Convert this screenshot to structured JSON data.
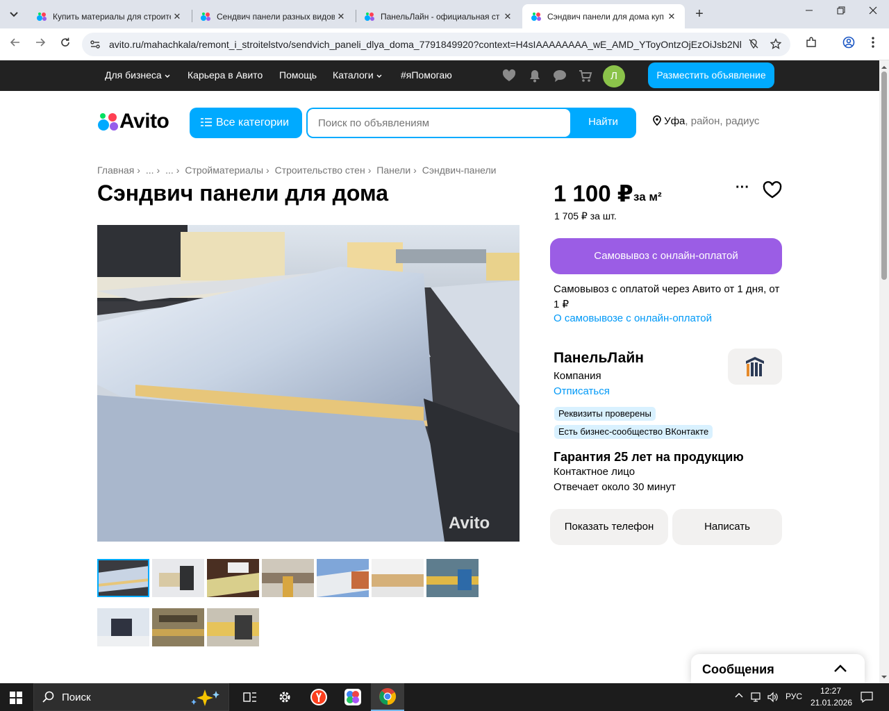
{
  "browser": {
    "tabs": [
      {
        "title": "Купить материалы для строите",
        "active": false
      },
      {
        "title": "Сендвич панели разных видов",
        "active": false
      },
      {
        "title": "ПанельЛайн - официальная ст",
        "active": false
      },
      {
        "title": "Сэндвич панели для дома куп",
        "active": true
      }
    ],
    "close_glyph": "✕",
    "new_tab_glyph": "+",
    "url": "avito.ru/mahachkala/remont_i_stroitelstvo/sendvich_paneli_dlya_doma_7791849920?context=H4sIAAAAAAAA_wE_AMD_YToyOntzOjEzOiJsb2Nhb..."
  },
  "topnav": {
    "links": [
      "Для бизнеса",
      "Карьера в Авито",
      "Помощь",
      "Каталоги",
      "#яПомогаю"
    ],
    "avatar_letter": "Л",
    "post_button": "Разместить объявление"
  },
  "header": {
    "logo_text": "Avito",
    "categories_button": "Все категории",
    "search_placeholder": "Поиск по объявлениям",
    "search_button": "Найти",
    "location_city": "Уфа",
    "location_rest": ", район, радиус"
  },
  "breadcrumbs": [
    "Главная",
    "...",
    "...",
    "Стройматериалы",
    "Строительство стен",
    "Панели",
    "Сэндвич-панели"
  ],
  "breadcrumb_sep": "›",
  "listing": {
    "title": "Сэндвич панели для дома",
    "price": "1 100 ₽",
    "price_unit": "за м²",
    "price_alt": "1 705 ₽ за шт.",
    "more_glyph": "···",
    "pickup_button": "Самовывоз с онлайн-оплатой",
    "pickup_text": "Самовывоз с оплатой через Авито от 1 дня, от 1 ₽",
    "pickup_link": "О самовывозе с онлайн-оплатой",
    "watermark": "Avito"
  },
  "seller": {
    "name": "ПанельЛайн",
    "type": "Компания",
    "unsubscribe": "Отписаться",
    "badges": [
      "Реквизиты проверены",
      "Есть бизнес-сообщество ВКонтакте"
    ],
    "guarantee": "Гарантия 25 лет на продукцию",
    "contact": "Контактное лицо",
    "responds": "Отвечает около 30 минут",
    "phone_button": "Показать телефон",
    "write_button": "Написать"
  },
  "messages": {
    "title": "Сообщения"
  },
  "taskbar": {
    "search_text": "Поиск",
    "lang": "РУС",
    "time": "12:27",
    "date": "21.01.2026"
  },
  "colors": {
    "accent_blue": "#00aaff",
    "purple": "#9b5de5",
    "link_blue": "#0099f7",
    "topnav_bg": "#222222",
    "badge_bg": "#d9f1ff"
  }
}
